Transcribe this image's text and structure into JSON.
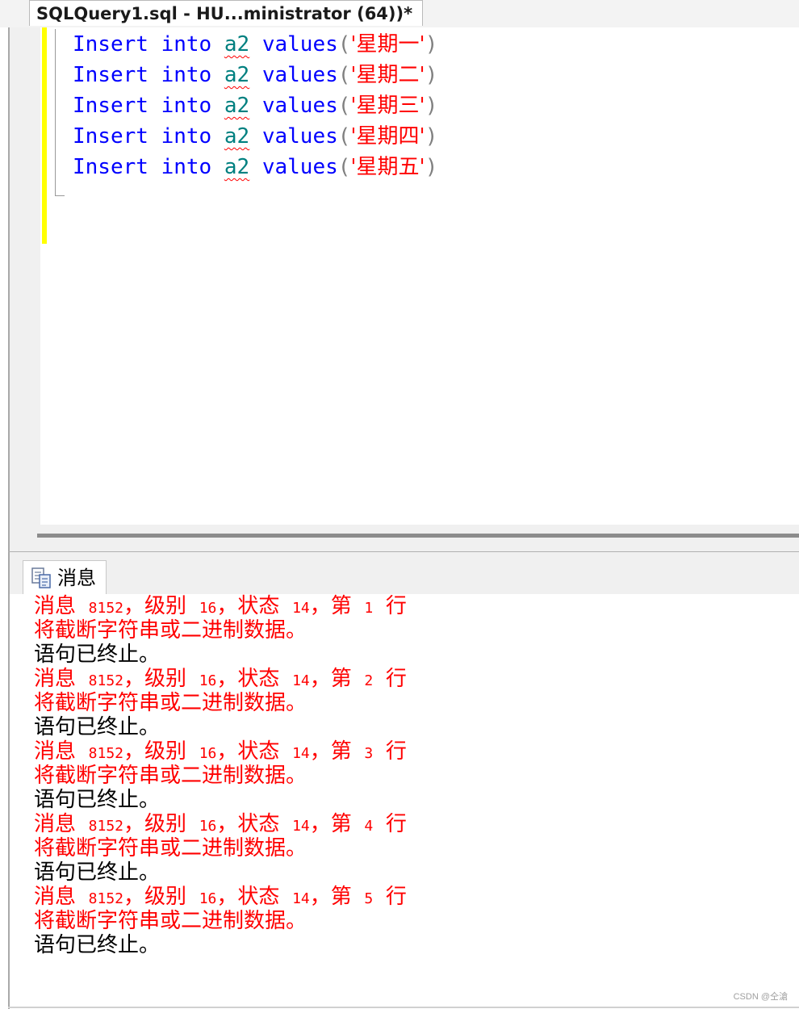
{
  "tab": {
    "title": "SQLQuery1.sql - HU...ministrator (64))*"
  },
  "editor": {
    "lines": [
      {
        "kw1": "Insert",
        "kw2": "into",
        "table": "a2",
        "kw3": "values",
        "open": "(",
        "str": "'星期一'",
        "close": ")"
      },
      {
        "kw1": "Insert",
        "kw2": "into",
        "table": "a2",
        "kw3": "values",
        "open": "(",
        "str": "'星期二'",
        "close": ")"
      },
      {
        "kw1": "Insert",
        "kw2": "into",
        "table": "a2",
        "kw3": "values",
        "open": "(",
        "str": "'星期三'",
        "close": ")"
      },
      {
        "kw1": "Insert",
        "kw2": "into",
        "table": "a2",
        "kw3": "values",
        "open": "(",
        "str": "'星期四'",
        "close": ")"
      },
      {
        "kw1": "Insert",
        "kw2": "into",
        "table": "a2",
        "kw3": "values",
        "open": "(",
        "str": "'星期五'",
        "close": ")"
      }
    ]
  },
  "results": {
    "tab_label": "消息",
    "tab_icon": "messages-icon",
    "messages": [
      {
        "a": "消息",
        "n1": "8152",
        "b": "，级别",
        "n2": "16",
        "c": "，状态",
        "n3": "14",
        "d": "，第",
        "n4": "1",
        "e": "行",
        "line2": "将截断字符串或二进制数据。",
        "line3": "语句已终止。"
      },
      {
        "a": "消息",
        "n1": "8152",
        "b": "，级别",
        "n2": "16",
        "c": "，状态",
        "n3": "14",
        "d": "，第",
        "n4": "2",
        "e": "行",
        "line2": "将截断字符串或二进制数据。",
        "line3": "语句已终止。"
      },
      {
        "a": "消息",
        "n1": "8152",
        "b": "，级别",
        "n2": "16",
        "c": "，状态",
        "n3": "14",
        "d": "，第",
        "n4": "3",
        "e": "行",
        "line2": "将截断字符串或二进制数据。",
        "line3": "语句已终止。"
      },
      {
        "a": "消息",
        "n1": "8152",
        "b": "，级别",
        "n2": "16",
        "c": "，状态",
        "n3": "14",
        "d": "，第",
        "n4": "4",
        "e": "行",
        "line2": "将截断字符串或二进制数据。",
        "line3": "语句已终止。"
      },
      {
        "a": "消息",
        "n1": "8152",
        "b": "，级别",
        "n2": "16",
        "c": "，状态",
        "n3": "14",
        "d": "，第",
        "n4": "5",
        "e": "行",
        "line2": "将截断字符串或二进制数据。",
        "line3": "语句已终止。"
      }
    ]
  },
  "watermark": "CSDN @仝滄",
  "colors": {
    "keyword": "#0000ff",
    "identifier": "#008080",
    "string": "#ff0000",
    "error": "#ff0000",
    "change_bar": "#ffff00"
  }
}
